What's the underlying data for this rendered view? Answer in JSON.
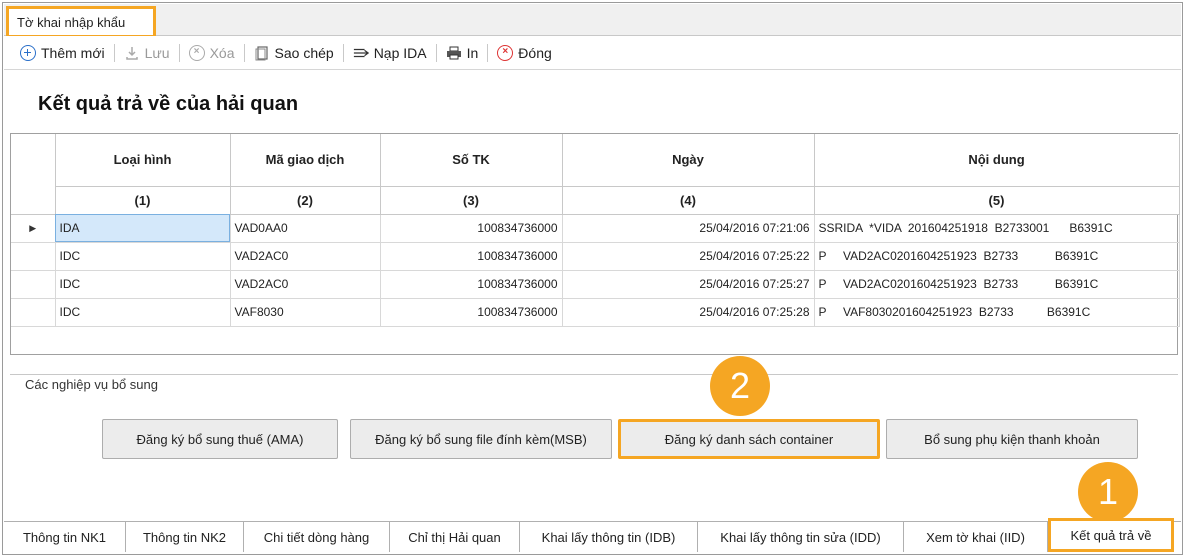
{
  "window": {
    "doc_tab_label": "Tờ khai nhập khẩu"
  },
  "toolbar": {
    "items": [
      {
        "label": "Thêm mới",
        "icon": "plus-circle-icon",
        "enabled": true
      },
      {
        "label": "Lưu",
        "icon": "save-icon",
        "enabled": false
      },
      {
        "label": "Xóa",
        "icon": "delete-icon",
        "enabled": false
      },
      {
        "label": "Sao chép",
        "icon": "copy-icon",
        "enabled": true
      },
      {
        "label": "Nạp IDA",
        "icon": "load-icon",
        "enabled": true
      },
      {
        "label": "In",
        "icon": "printer-icon",
        "enabled": true
      },
      {
        "label": "Đóng",
        "icon": "close-icon",
        "enabled": true
      }
    ]
  },
  "main": {
    "title": "Kết quả trả về của hải quan",
    "columns": [
      {
        "label": "Loại hình",
        "index": "(1)"
      },
      {
        "label": "Mã giao dịch",
        "index": "(2)"
      },
      {
        "label": "Số TK",
        "index": "(3)"
      },
      {
        "label": "Ngày",
        "index": "(4)"
      },
      {
        "label": "Nội dung",
        "index": "(5)"
      }
    ],
    "rows": [
      {
        "loai_hinh": "IDA",
        "ma_giao_dich": "VAD0AA0",
        "so_tk": "100834736000",
        "ngay": "25/04/2016 07:21:06",
        "noi_dung": "SSRIDA  *VIDA  201604251918  B2733001      B6391C",
        "selected": true
      },
      {
        "loai_hinh": "IDC",
        "ma_giao_dich": "VAD2AC0",
        "so_tk": "100834736000",
        "ngay": "25/04/2016 07:25:22",
        "noi_dung": "P     VAD2AC0201604251923  B2733           B6391C",
        "selected": false
      },
      {
        "loai_hinh": "IDC",
        "ma_giao_dich": "VAD2AC0",
        "so_tk": "100834736000",
        "ngay": "25/04/2016 07:25:27",
        "noi_dung": "P     VAD2AC0201604251923  B2733           B6391C",
        "selected": false
      },
      {
        "loai_hinh": "IDC",
        "ma_giao_dich": "VAF8030",
        "so_tk": "100834736000",
        "ngay": "25/04/2016 07:25:28",
        "noi_dung": "P     VAF8030201604251923  B2733          B6391C",
        "selected": false
      }
    ]
  },
  "supplementary": {
    "group_label": "Các nghiệp vụ bổ sung",
    "buttons": [
      {
        "label": "Đăng ký bổ sung thuế (AMA)",
        "highlighted": false
      },
      {
        "label": "Đăng ký bổ sung file đính kèm(MSB)",
        "highlighted": false
      },
      {
        "label": "Đăng ký danh sách container",
        "highlighted": true
      },
      {
        "label": "Bổ sung phụ kiện thanh khoản",
        "highlighted": false
      }
    ]
  },
  "badges": [
    "1",
    "2"
  ],
  "bottom_tabs": [
    {
      "label": "Thông tin NK1",
      "active": false
    },
    {
      "label": "Thông tin NK2",
      "active": false
    },
    {
      "label": "Chi tiết dòng hàng",
      "active": false
    },
    {
      "label": "Chỉ thị Hải quan",
      "active": false
    },
    {
      "label": "Khai lấy thông tin (IDB)",
      "active": false
    },
    {
      "label": "Khai lấy thông tin sửa (IDD)",
      "active": false
    },
    {
      "label": "Xem tờ khai (IID)",
      "active": false
    },
    {
      "label": "Kết quả trả về",
      "active": true
    }
  ],
  "colors": {
    "highlight": "#f5a623",
    "selection": "#d4e8fa",
    "close_red": "#dd3333",
    "add_blue": "#2a6fc9"
  }
}
